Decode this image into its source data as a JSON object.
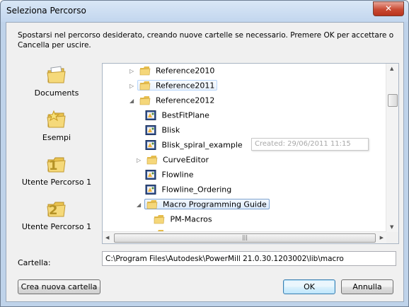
{
  "window": {
    "title": "Seleziona Percorso",
    "close_label": "✕"
  },
  "instructions": "Spostarsi nel percorso desiderato, creando nuove cartelle se necessario. Premere OK per accettare o Cancella per uscire.",
  "places": [
    {
      "label": "Documents",
      "icon": "documents-folder-icon"
    },
    {
      "label": "Esempi",
      "icon": "star-folder-icon"
    },
    {
      "label": "Utente Percorso 1",
      "icon": "user-path-1-folder-icon"
    },
    {
      "label": "Utente Percorso 1",
      "icon": "user-path-2-folder-icon"
    }
  ],
  "tree": {
    "items": [
      {
        "label": "Reference2010",
        "type": "folder",
        "expander": "collapsed"
      },
      {
        "label": "Reference2011",
        "type": "folder",
        "expander": "collapsed",
        "state": "hover"
      },
      {
        "label": "Reference2012",
        "type": "folder",
        "expander": "expanded"
      },
      {
        "label": "BestFitPlane",
        "type": "macro"
      },
      {
        "label": "Blisk",
        "type": "macro"
      },
      {
        "label": "Blisk_spiral_example",
        "type": "macro"
      },
      {
        "label": "CurveEditor",
        "type": "folder",
        "expander": "collapsed"
      },
      {
        "label": "Flowline",
        "type": "macro"
      },
      {
        "label": "Flowline_Ordering",
        "type": "macro"
      },
      {
        "label": "Macro Programming Guide",
        "type": "folder",
        "expander": "expanded",
        "state": "selected"
      },
      {
        "label": "PM-Macros",
        "type": "folder"
      }
    ],
    "tooltip": "Created: 29/06/2011 11:15"
  },
  "folder": {
    "label": "Cartella:",
    "value": "C:\\Program Files\\Autodesk\\PowerMill 21.0.30.1203002\\lib\\macro"
  },
  "buttons": {
    "new_folder": "Crea nuova cartella",
    "ok": "OK",
    "cancel": "Annulla"
  },
  "colors": {
    "selection_border": "#7da2ce",
    "folder_yellow": "#f3d36a",
    "title_bar": "#c2d6ee"
  }
}
